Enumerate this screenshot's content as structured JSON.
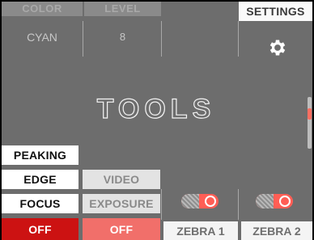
{
  "tabs": {
    "color": {
      "label": "COLOR",
      "value": "CYAN"
    },
    "level": {
      "label": "LEVEL",
      "value": "8"
    },
    "settings": {
      "label": "SETTINGS",
      "icon": "gear-icon"
    }
  },
  "title": "TOOLS",
  "left_buttons": {
    "peaking": "PEAKING",
    "edge": "EDGE",
    "focus": "FOCUS",
    "focus_state": "OFF"
  },
  "mid_buttons": {
    "video": "VIDEO",
    "exposure": "EXPOSURE",
    "exposure_state": "OFF"
  },
  "zebra": {
    "zebra1": {
      "label": "ZEBRA 1",
      "enabled": true
    },
    "zebra2": {
      "label": "ZEBRA 2",
      "enabled": true
    }
  },
  "colors": {
    "background": "#6d6d6d",
    "accent_red": "#cc1212",
    "accent_pink": "#f16f6a",
    "toggle_on": "#ff5e55"
  }
}
